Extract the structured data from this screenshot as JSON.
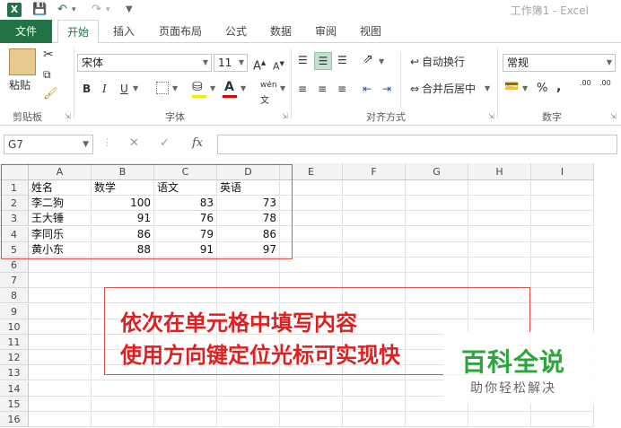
{
  "app": {
    "window_title": "工作簿1 - Excel",
    "logo": "X"
  },
  "quick_access": {
    "save_icon": "save-icon",
    "undo_icon": "undo-icon",
    "redo_icon": "redo-icon",
    "customize_icon": "customize-icon"
  },
  "tabs": [
    {
      "label": "文件"
    },
    {
      "label": "开始"
    },
    {
      "label": "插入"
    },
    {
      "label": "页面布局"
    },
    {
      "label": "公式"
    },
    {
      "label": "数据"
    },
    {
      "label": "审阅"
    },
    {
      "label": "视图"
    }
  ],
  "ribbon": {
    "clipboard": {
      "label": "剪贴板",
      "paste": "粘贴"
    },
    "font": {
      "label": "字体",
      "name": "宋体",
      "size": "11",
      "bold": "B",
      "italic": "I",
      "underline": "U",
      "grow": "A",
      "shrink": "A",
      "color_a": "A",
      "wen": "wén"
    },
    "alignment": {
      "label": "对齐方式",
      "wrap": "自动换行",
      "merge": "合并后居中"
    },
    "number": {
      "label": "数字",
      "format": "常规",
      "percent": "%",
      "comma": ",",
      "dec_inc": ".00",
      "dec_dec": ".00"
    }
  },
  "formula_bar": {
    "name_box": "G7",
    "cancel": "✕",
    "enter": "✓",
    "fx": "fx",
    "value": ""
  },
  "columns": [
    "A",
    "B",
    "C",
    "D",
    "E",
    "F",
    "G",
    "H",
    "I"
  ],
  "rows": [
    "1",
    "2",
    "3",
    "4",
    "5",
    "6",
    "7",
    "8",
    "9",
    "10",
    "11",
    "12",
    "13",
    "14",
    "15",
    "16"
  ],
  "table": {
    "headers": [
      "姓名",
      "数学",
      "语文",
      "英语"
    ],
    "data": [
      [
        "李二狗",
        "100",
        "83",
        "73"
      ],
      [
        "王大锤",
        "91",
        "76",
        "78"
      ],
      [
        "李同乐",
        "86",
        "79",
        "86"
      ],
      [
        "黄小东",
        "88",
        "91",
        "97"
      ]
    ]
  },
  "annotation": {
    "line1": "依次在单元格中填写内容",
    "line2": "使用方向键定位光标可实现快"
  },
  "watermark": {
    "main": "百科全说",
    "sub": "助你轻松解决"
  },
  "colors": {
    "excel_green": "#217346",
    "annotation_red": "#e02020",
    "watermark_green": "#2aa63a"
  }
}
